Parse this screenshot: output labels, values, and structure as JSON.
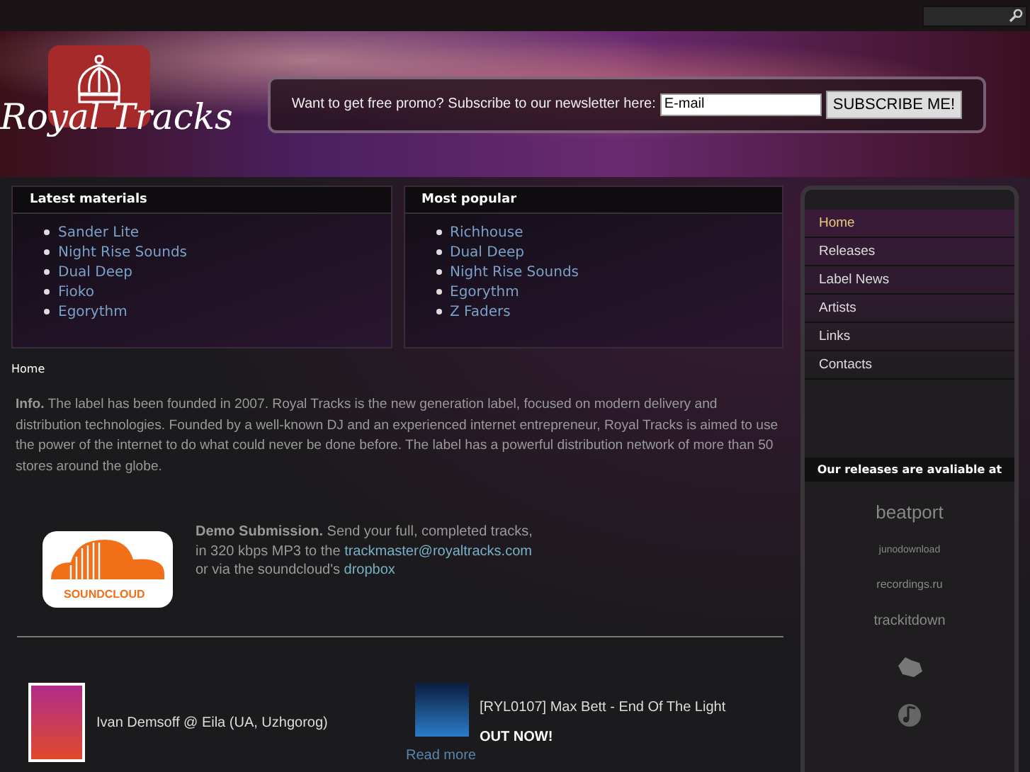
{
  "logo": {
    "text": "Royal Tracks"
  },
  "newsletter": {
    "prompt": "Want to get free promo? Subscribe to our newsletter here:",
    "placeholder": "E-mail",
    "button": "SUBSCRIBE ME!"
  },
  "latest_materials": {
    "title": "Latest materials",
    "items": [
      "Sander Lite",
      "Night Rise Sounds",
      "Dual Deep",
      "Fioko",
      "Egorythm"
    ]
  },
  "most_popular": {
    "title": "Most popular",
    "items": [
      "Richhouse",
      "Dual Deep",
      "Night Rise Sounds",
      "Egorythm",
      "Z Faders"
    ]
  },
  "breadcrumb": "Home",
  "info": "**Info.** The label has been founded in 2007. Royal Tracks is the new generation label, focused on modern delivery and distribution technologies. Founded by a well-known DJ and an experienced internet entrepreneur, Royal Tracks is aimed to use the power of the internet to do what could never be done before. The label has a powerful distribution network of more than 50 stores around the globe.",
  "demo": {
    "logo_text": "SOUNDCLOUD",
    "line_1": "**Demo Submission.** Send your full, completed tracks,",
    "line_2": "in 320 kbps MP3 to the",
    "email": "trackmaster@royaltracks.com",
    "line_3": "or via the soundcloud's",
    "link": "dropbox"
  },
  "news": [
    {
      "title": "Ivan Demsoff @ Eila (UA, Uzhgorog)"
    },
    {
      "title": "[RYL0107] Max Bett - End Of The Light",
      "subtitle": "OUT NOW!",
      "link": "Read more"
    }
  ],
  "nav": [
    {
      "label": "Home",
      "selected": true
    },
    {
      "label": "Releases",
      "selected": false
    },
    {
      "label": "Label News",
      "selected": false
    },
    {
      "label": "Artists",
      "selected": false
    },
    {
      "label": "Links",
      "selected": false
    },
    {
      "label": "Contacts",
      "selected": false
    }
  ],
  "stores": {
    "title": "Our releases are avaliable at",
    "logos": [
      "beatport",
      "junodownload",
      "recordings.ru",
      "trackitdown"
    ]
  }
}
